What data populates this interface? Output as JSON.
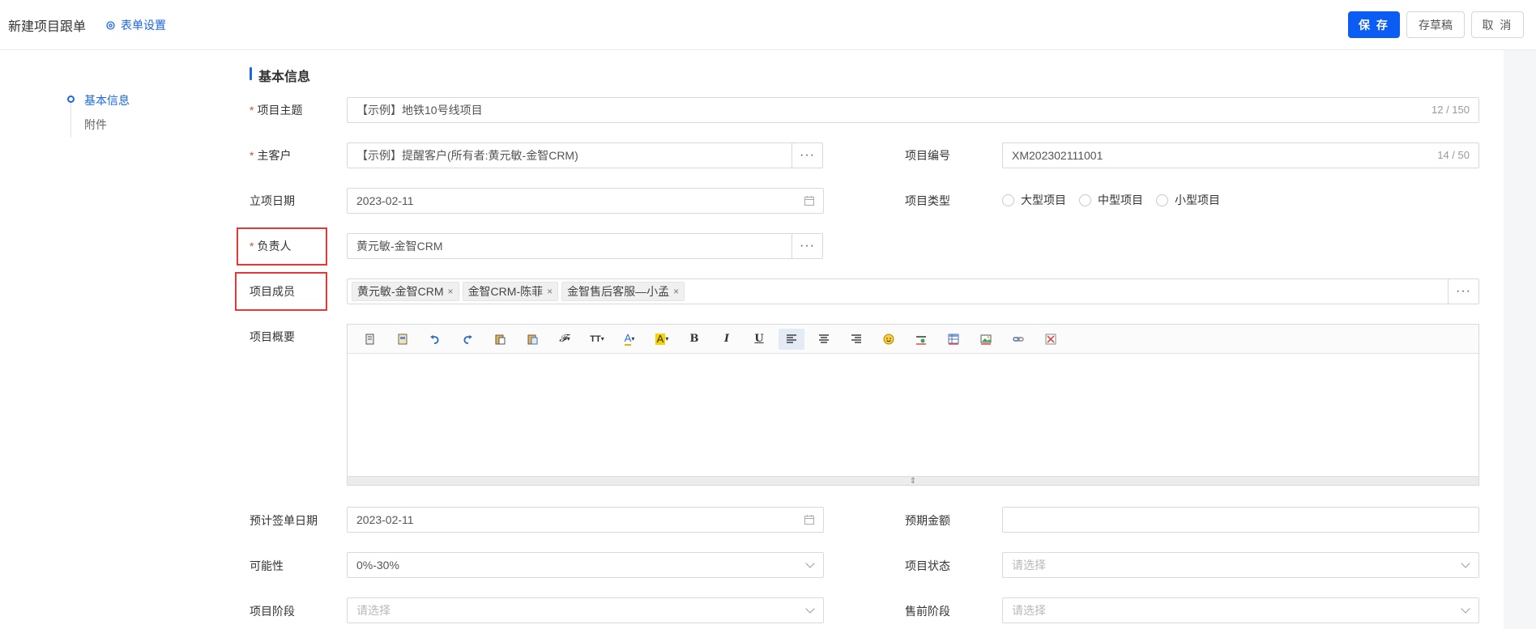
{
  "header": {
    "title": "新建项目跟单",
    "form_settings": "表单设置",
    "save": "保 存",
    "draft": "存草稿",
    "cancel": "取 消"
  },
  "anchor_nav": {
    "items": [
      "基本信息",
      "附件"
    ],
    "active": "基本信息"
  },
  "section": {
    "title": "基本信息"
  },
  "fields": {
    "subject": {
      "label": "项目主题",
      "required": true,
      "value": "【示例】地铁10号线项目",
      "count": "12 / 150"
    },
    "customer": {
      "label": "主客户",
      "required": true,
      "value": "【示例】提醒客户(所有者:黄元敏-金智CRM)"
    },
    "project_no": {
      "label": "项目编号",
      "value": "XM202302111001",
      "count": "14 / 50"
    },
    "start_date": {
      "label": "立项日期",
      "value": "2023-02-11"
    },
    "project_type": {
      "label": "项目类型",
      "options": [
        "大型项目",
        "中型项目",
        "小型项目"
      ]
    },
    "owner": {
      "label": "负责人",
      "required": true,
      "value": "黄元敏-金智CRM"
    },
    "members": {
      "label": "项目成员",
      "tags": [
        "黄元敏-金智CRM",
        "金智CRM-陈菲",
        "金智售后客服—小孟"
      ]
    },
    "summary": {
      "label": "项目概要"
    },
    "sign_date": {
      "label": "预计签单日期",
      "value": "2023-02-11"
    },
    "amount": {
      "label": "预期金额",
      "value": ""
    },
    "probability": {
      "label": "可能性",
      "value": "0%-30%"
    },
    "status": {
      "label": "项目状态",
      "placeholder": "请选择"
    },
    "stage": {
      "label": "项目阶段",
      "placeholder": "请选择"
    },
    "presale_stage": {
      "label": "售前阶段",
      "placeholder": "请选择"
    }
  },
  "editor_toolbar": [
    "source-icon",
    "template-icon",
    "undo-icon",
    "redo-icon",
    "paste-icon",
    "paste-text-icon",
    "font-family-icon",
    "font-size-icon",
    "font-color-icon",
    "highlight-icon",
    "bold-icon",
    "italic-icon",
    "underline-icon",
    "align-left-icon",
    "align-center-icon",
    "align-right-icon",
    "emoji-icon",
    "horizontal-rule-icon",
    "table-icon",
    "image-icon",
    "link-icon",
    "remove-format-icon"
  ],
  "colors": {
    "accent": "#1a66e8",
    "primary_button": "#0b5cf2",
    "required": "#e8453c",
    "highlight_box": "#e53935"
  }
}
